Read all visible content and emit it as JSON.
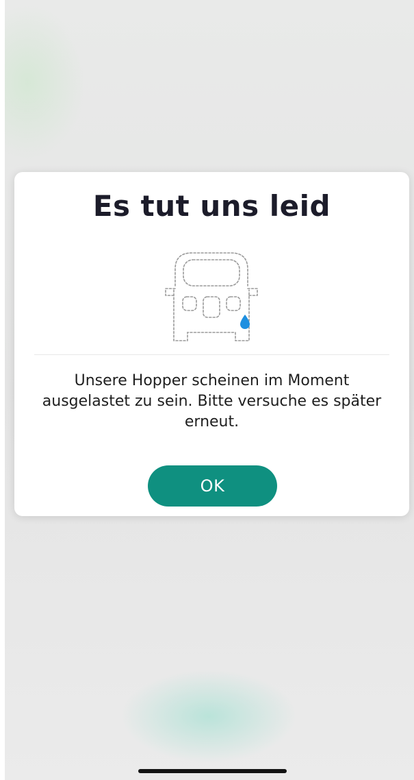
{
  "dialog": {
    "title": "Es tut uns leid",
    "message": "Unsere Hopper scheinen im Moment ausgelastet zu sein. Bitte versuche es später erneut.",
    "ok_label": "OK",
    "illustration_icon": "sad-van-icon"
  },
  "colors": {
    "accent": "#0f9080",
    "title": "#1c1c2a",
    "tear": "#1e8fe0"
  }
}
